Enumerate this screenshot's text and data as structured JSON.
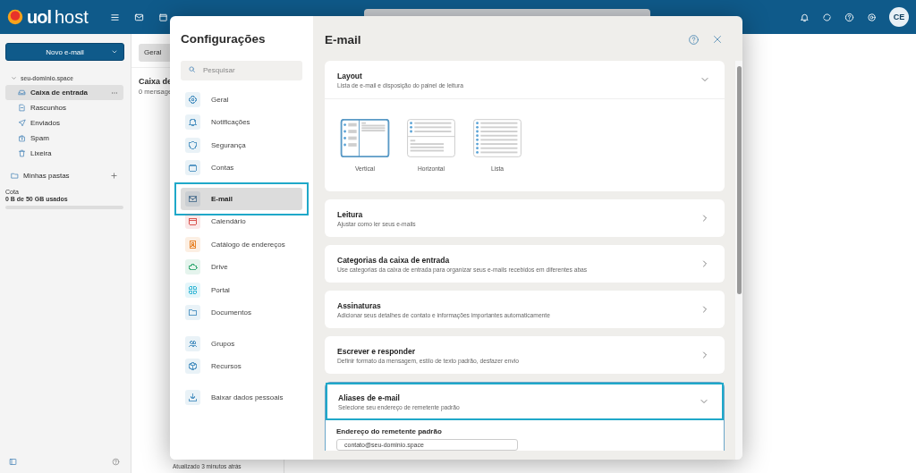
{
  "header": {
    "logo": {
      "brand": "uol",
      "product": "host"
    },
    "avatar": "CE"
  },
  "sidebar": {
    "new_button": "Novo e-mail",
    "account": {
      "name": "seu-dominio.space",
      "expanded": true
    },
    "folders": [
      {
        "label": "Caixa de entrada",
        "selected": true
      },
      {
        "label": "Rascunhos",
        "selected": false
      },
      {
        "label": "Enviados",
        "selected": false
      },
      {
        "label": "Spam",
        "selected": false
      },
      {
        "label": "Lixeira",
        "selected": false
      }
    ],
    "my_folders": "Minhas pastas",
    "quota": {
      "label": "Cota",
      "usage": "0 B de 50 GB usados",
      "level": 0
    }
  },
  "message_list": {
    "filter": "Geral",
    "title": "Caixa de",
    "count": "0 mensage",
    "status": "Atualizado 3 minutos atrás"
  },
  "settings": {
    "title": "Configurações",
    "search_placeholder": "Pesquisar",
    "nav_groups": [
      [
        {
          "label": "Geral",
          "selected": false,
          "highlighted": false,
          "color": "#5a9ac6"
        },
        {
          "label": "Notificações",
          "selected": false,
          "highlighted": false,
          "color": "#5a9ac6"
        },
        {
          "label": "Segurança",
          "selected": false,
          "highlighted": false,
          "color": "#5a9ac6"
        },
        {
          "label": "Contas",
          "selected": false,
          "highlighted": false,
          "color": "#5a9ac6"
        }
      ],
      [
        {
          "label": "E-mail",
          "selected": true,
          "highlighted": true,
          "color": "#5a7a96"
        },
        {
          "label": "Calendário",
          "selected": false,
          "highlighted": false,
          "color": "#d9534f"
        },
        {
          "label": "Catálogo de endereços",
          "selected": false,
          "highlighted": false,
          "color": "#e8852b"
        },
        {
          "label": "Drive",
          "selected": false,
          "highlighted": false,
          "color": "#3fae7a"
        },
        {
          "label": "Portal",
          "selected": false,
          "highlighted": false,
          "color": "#3bb9d6"
        },
        {
          "label": "Documentos",
          "selected": false,
          "highlighted": false,
          "color": "#5a9ac6"
        }
      ],
      [
        {
          "label": "Grupos",
          "selected": false,
          "highlighted": false,
          "color": "#5a9ac6"
        },
        {
          "label": "Recursos",
          "selected": false,
          "highlighted": false,
          "color": "#5a9ac6"
        }
      ],
      [
        {
          "label": "Baixar dados pessoais",
          "selected": false,
          "highlighted": false,
          "color": "#5a9ac6"
        }
      ]
    ],
    "panel_title": "E-mail",
    "sections": [
      {
        "title": "Layout",
        "subtitle": "Lista de e-mail e disposição do painel de leitura",
        "expanded": true,
        "highlighted": false,
        "kind": "layout",
        "options": [
          {
            "label": "Vertical",
            "selected": true
          },
          {
            "label": "Horizontal",
            "selected": false
          },
          {
            "label": "Lista",
            "selected": false
          }
        ]
      },
      {
        "title": "Leitura",
        "subtitle": "Ajustar como ler seus e-mails",
        "highlighted": false,
        "kind": "link"
      },
      {
        "title": "Categorias da caixa de entrada",
        "subtitle": "Use categorias da caixa de entrada para organizar seus e-mails recebidos em diferentes abas",
        "highlighted": false,
        "kind": "link"
      },
      {
        "title": "Assinaturas",
        "subtitle": "Adicionar seus detalhes de contato e informações importantes automaticamente",
        "highlighted": false,
        "kind": "link"
      },
      {
        "title": "Escrever e responder",
        "subtitle": "Definir formato da mensagem, estilo de texto padrão, desfazer envio",
        "highlighted": false,
        "kind": "link"
      },
      {
        "title": "Aliases de e-mail",
        "subtitle": "Selecione seu endereço de remetente padrão",
        "expanded": true,
        "highlighted": true,
        "kind": "alias",
        "field_label": "Endereço do remetente padrão",
        "field_value": "contato@seu-dominio.space"
      }
    ]
  }
}
